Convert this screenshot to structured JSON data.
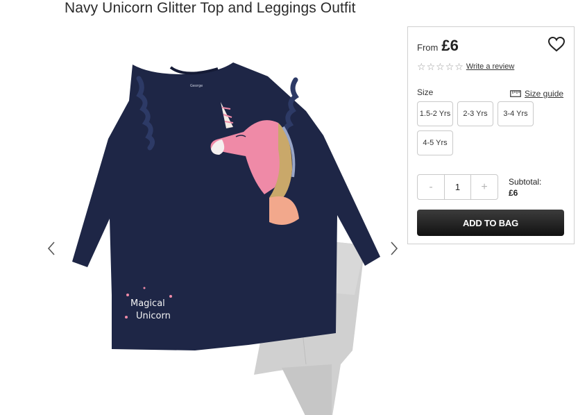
{
  "product": {
    "title": "Navy Unicorn Glitter Top and Leggings Outfit",
    "image_text": {
      "line1": "Magical",
      "line2": "Unicorn",
      "brand_tag": "George"
    }
  },
  "gallery": {
    "icons": {
      "prev": "chevron-left-icon",
      "next": "chevron-right-icon"
    }
  },
  "panel": {
    "price_prefix": "From",
    "price": "£6",
    "wishlist_icon": "heart-icon",
    "rating": {
      "stars_total": 5,
      "stars_filled": 0,
      "write_review": "Write a review"
    },
    "size_label": "Size",
    "size_guide": "Size guide",
    "size_guide_icon": "ruler-icon",
    "sizes": [
      "1.5-2 Yrs",
      "2-3 Yrs",
      "3-4 Yrs",
      "4-5 Yrs"
    ],
    "quantity": {
      "minus": "-",
      "value": "1",
      "plus": "+"
    },
    "subtotal_label": "Subtotal:",
    "subtotal_value": "£6",
    "add_to_bag": "ADD TO BAG"
  },
  "colors": {
    "navy": "#1e2646",
    "button_dark": "#222222",
    "legging_grey": "#cfcfcf",
    "unicorn_pink": "#ef8aa7"
  }
}
